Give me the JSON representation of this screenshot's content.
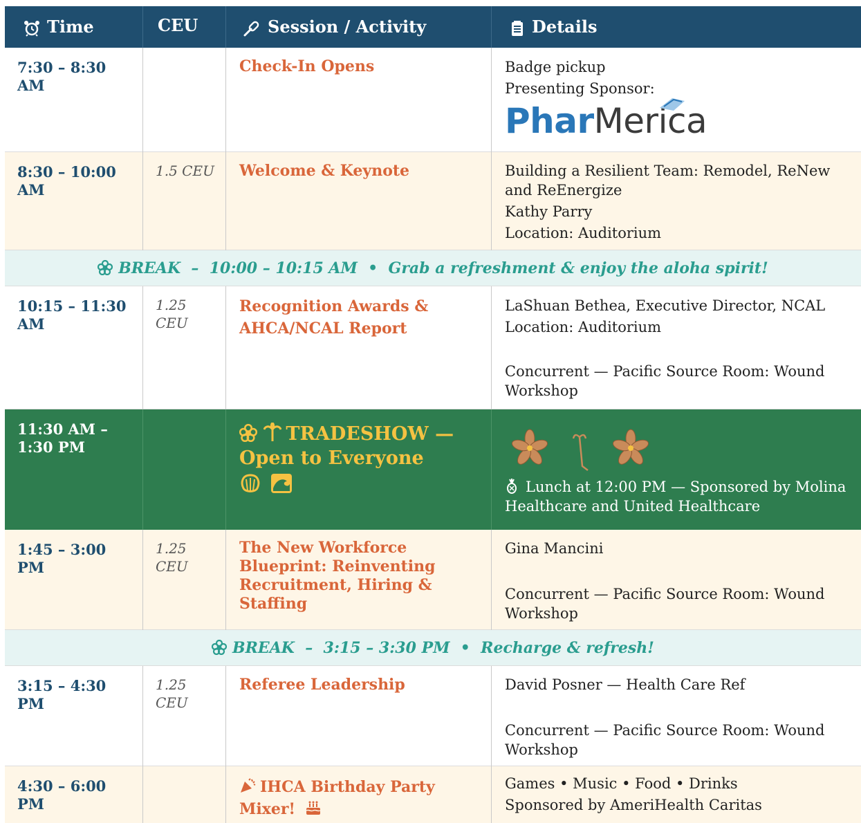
{
  "header": {
    "time": "Time",
    "ceu": "CEU",
    "session": "Session / Activity",
    "details": "Details"
  },
  "rows": [
    {
      "time": "7:30 – 8:30 AM",
      "ceu": "",
      "session": "Check-In Opens",
      "details": [
        "Badge pickup",
        "Presenting Sponsor:"
      ],
      "sponsor_logo": "PharMerica"
    },
    {
      "time": "8:30 – 10:00 AM",
      "ceu": "1.5 CEU",
      "session": "Welcome & Keynote",
      "details": [
        "Building a Resilient Team: Remodel, ReNew and ReEnergize",
        "Kathy Parry",
        "Location: Auditorium"
      ]
    },
    {
      "break": "BREAK  –  10:00 – 10:15 AM  •  Grab a refreshment & enjoy the aloha spirit!"
    },
    {
      "time": "10:15 – 11:30 AM",
      "ceu": "1.25 CEU",
      "session": "Recognition Awards & AHCA/NCAL Report",
      "details": [
        "LaShuan Bethea, Executive Director, NCAL",
        "Location: Auditorium",
        "Concurrent — Pacific Source Room: Wound Workshop"
      ]
    },
    {
      "time": "11:30 AM – 1:30 PM",
      "ceu": "",
      "session": "TRADESHOW — Open to Everyone",
      "details": [
        "Lunch at 12:00 PM — Sponsored by Molina Healthcare and United Healthcare"
      ]
    },
    {
      "time": "1:45 – 3:00 PM",
      "ceu": "1.25 CEU",
      "session": "The New Workforce Blueprint: Reinventing Recruitment, Hiring & Staffing",
      "details": [
        "Gina Mancini",
        "Concurrent — Pacific Source Room: Wound Workshop"
      ]
    },
    {
      "break": "BREAK  –  3:15 – 3:30 PM  •  Recharge & refresh!"
    },
    {
      "time": "3:15 – 4:30 PM",
      "ceu": "1.25 CEU",
      "session": "Referee Leadership",
      "details": [
        "David Posner — Health Care Ref",
        "Concurrent — Pacific Source Room: Wound Workshop"
      ]
    },
    {
      "time": "4:30 – 6:00 PM",
      "ceu": "",
      "session": "IHCA Birthday Party Mixer!",
      "details": [
        "Games • Music • Food • Drinks",
        "Sponsored by AmeriHealth Caritas"
      ]
    }
  ],
  "colors": {
    "header_bg": "#1f4e6f",
    "time_text": "#1f4e6f",
    "session_text": "#d9663a",
    "cream_row": "#fef6e7",
    "break_row": "#e6f4f3",
    "break_text": "#2a9d8f",
    "tradeshow_bg": "#2e7d4f",
    "tradeshow_title": "#f5c242"
  },
  "icons": [
    "alarm-clock-icon",
    "microphone-icon",
    "notepad-icon",
    "flower-icon",
    "palm-tree-icon",
    "shell-icon",
    "wave-icon",
    "pineapple-icon",
    "party-popper-icon",
    "birthday-cake-icon"
  ]
}
